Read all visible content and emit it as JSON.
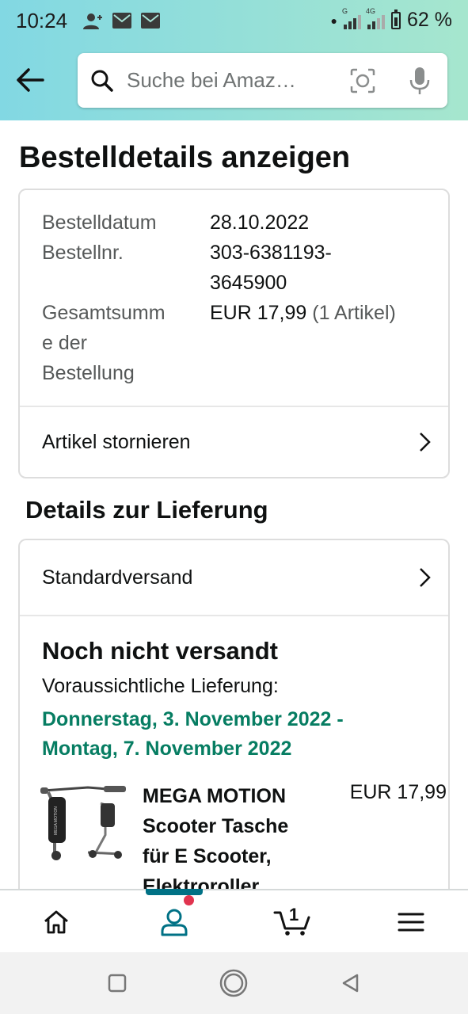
{
  "status_bar": {
    "time": "10:24",
    "battery": "62 %",
    "notification_icons": [
      "person-add-icon",
      "mail-icon",
      "mail-icon"
    ],
    "signal_labels": [
      "G",
      "4G"
    ]
  },
  "search": {
    "placeholder": "Suche bei Amaz…"
  },
  "page": {
    "title": "Bestelldetails anzeigen"
  },
  "order": {
    "date_label": "Bestelldatum",
    "date_value": "28.10.2022",
    "number_label": "Bestellnr.",
    "number_value_line1": "303-6381193-",
    "number_value_line2": "3645900",
    "total_label_line1": "Gesamtsumm",
    "total_label_line2": "e der",
    "total_label_line3": "Bestellung",
    "total_value": "EUR 17,99",
    "total_count": "(1 Artikel)",
    "cancel_label": "Artikel stornieren"
  },
  "delivery": {
    "section_title": "Details zur Lieferung",
    "shipping_method": "Standardversand",
    "status": "Noch nicht versandt",
    "expected_label": "Voraussichtliche Lieferung:",
    "expected_line1": "Donnerstag, 3. November 2022 -",
    "expected_line2": "Montag, 7. November 2022",
    "colors": {
      "date_green": "#067d62"
    }
  },
  "product": {
    "title_line1": "MEGA MOTION",
    "title_line2": "Scooter Tasche",
    "title_line3": "für E Scooter,",
    "title_line4": "Elektroroller,",
    "price": "EUR 17,99",
    "image_text": "MEGA MOTION"
  },
  "bottom_nav": {
    "items": [
      "home-icon",
      "account-icon",
      "cart-icon",
      "menu-icon"
    ],
    "active": "account-icon",
    "cart_count": "1",
    "colors": {
      "active": "#007185",
      "badge": "#e1344f"
    }
  },
  "system_nav": [
    "recents-button",
    "home-button",
    "back-button"
  ]
}
